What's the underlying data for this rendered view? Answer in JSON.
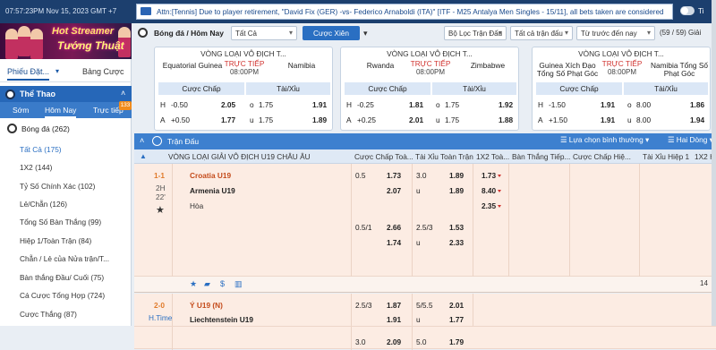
{
  "topbar": {
    "clock": "07:57:23PM Nov 15, 2023 GMT +7",
    "ticker": "Attn:[Tennis] Due to player retirement, \"David Fix (GER) -vs- Federico Arnaboldi (ITA)\" [ITF - M25 Antalya Men Singles - 15/11], all bets taken are considered",
    "toggle_label": "Ti"
  },
  "banner": {
    "line1": "Hot Streamer",
    "line2": "Tướng Thuật"
  },
  "left": {
    "tab_ticket": "Phiếu Đặt...",
    "tab_table": "Bảng Cược",
    "sports_title": "Thể Thao",
    "period_tabs": [
      "Sớm",
      "Hôm Nay",
      "Trực tiếp"
    ],
    "live_badge": "133",
    "football": "Bóng đá (262)",
    "items": [
      "Tất Cả (175)",
      "1X2 (144)",
      "Tỷ Số Chính Xác (102)",
      "Lẻ/Chẵn (126)",
      "Tổng Số Bàn Thắng (99)",
      "Hiệp 1/Toàn Trận (84)",
      "Chẵn / Lẻ của Nửa trận/T...",
      "Bàn thắng Đầu/ Cuối (75)",
      "Cá Cược Tổng Hợp (724)",
      "Cược Thắng (87)"
    ]
  },
  "filter": {
    "title": "Bóng đá / Hôm Nay",
    "select_all": "Tất Cả",
    "xien": "Cược Xiên",
    "league_filter": "Bộ Lọc Trận Đấu",
    "all_matches": "Tất cả trận đấu",
    "order": "Từ trước đến nay",
    "count": "(59 / 59) Giải"
  },
  "cards": [
    {
      "league": "VÒNG LOẠI VÔ ĐỊCH T...",
      "home": "Equatorial Guinea",
      "away": "Namibia",
      "live": "TRỰC TIẾP",
      "time": "08:00PM",
      "hdr_left": "Cược Chấp",
      "hdr_right": "Tài/Xỉu",
      "rows": [
        {
          "a": "H",
          "b": "-0.50",
          "c": "2.05",
          "d": "o",
          "e": "1.75",
          "f": "1.91"
        },
        {
          "a": "A",
          "b": "+0.50",
          "c": "1.77",
          "d": "u",
          "e": "1.75",
          "f": "1.89"
        }
      ]
    },
    {
      "league": "VÒNG LOẠI VÔ ĐỊCH T...",
      "home": "Rwanda",
      "away": "Zimbabwe",
      "live": "TRỰC TIẾP",
      "time": "08:00PM",
      "hdr_left": "Cược Chấp",
      "hdr_right": "Tài/Xỉu",
      "rows": [
        {
          "a": "H",
          "b": "-0.25",
          "c": "1.81",
          "d": "o",
          "e": "1.75",
          "f": "1.92"
        },
        {
          "a": "A",
          "b": "+0.25",
          "c": "2.01",
          "d": "u",
          "e": "1.75",
          "f": "1.88"
        }
      ]
    },
    {
      "league": "VÒNG LOẠI VÔ ĐỊCH T...",
      "home": "Guinea Xích Đạo Tổng Số Phạt Góc",
      "away": "Namibia Tổng Số Phạt Góc",
      "live": "TRỰC TIẾP",
      "time": "08:00PM",
      "hdr_left": "Cược Chấp",
      "hdr_right": "Tài/Xỉu",
      "rows": [
        {
          "a": "H",
          "b": "-1.50",
          "c": "1.91",
          "d": "o",
          "e": "8.00",
          "f": "1.86"
        },
        {
          "a": "A",
          "b": "+1.50",
          "c": "1.91",
          "d": "u",
          "e": "8.00",
          "f": "1.94"
        }
      ]
    }
  ],
  "table": {
    "header": "Trận Đấu",
    "sort": "Lựa chọn bình thường",
    "side": "Hai Dòng",
    "league": "VÒNG LOẠI GIẢI VÔ ĐỊCH U19 CHÂU ÂU",
    "cols": [
      "Cược Chấp Toà...",
      "Tài Xỉu Toàn Trận",
      "1X2 Toà...",
      "Bàn Thắng Tiếp...",
      "Cược Chấp Hiệ...",
      "Tài Xỉu Hiệp 1",
      "1X2 H"
    ]
  },
  "match1": {
    "score": "1-1",
    "period": "2H",
    "minute": "22'",
    "home": "Croatia U19",
    "away": "Armenia U19",
    "draw": "Hòa",
    "hc1": "0.5",
    "hc1_h": "1.73",
    "hc1_a": "2.07",
    "ou1": "3.0",
    "ou1_o": "1.89",
    "ou1_lab": "u",
    "ou1_u": "1.89",
    "x12_1": "1.73",
    "x12_2": "8.40",
    "x12_x": "2.35",
    "hc2": "0.5/1",
    "hc2_h": "2.66",
    "hc2_a": "1.74",
    "ou2": "2.5/3",
    "ou2_o": "1.53",
    "ou2_lab": "u",
    "ou2_u": "2.33",
    "more": "14"
  },
  "match2": {
    "score": "2-0",
    "period": "H.Time",
    "home": "Ý U19 (N)",
    "away": "Liechtenstein U19",
    "hc1": "2.5/3",
    "hc1_h": "1.87",
    "hc1_a": "1.91",
    "ou1": "5/5.5",
    "ou1_o": "2.01",
    "ou1_lab": "u",
    "ou1_u": "1.77",
    "hc2": "3.0",
    "hc2_h": "2.09",
    "ou2": "5.0",
    "ou2_o": "1.79"
  },
  "colors": {
    "brand": "#1c3f6e",
    "accent": "#2a6fc2",
    "live": "#d0332f",
    "fav": "#c44b1b"
  }
}
